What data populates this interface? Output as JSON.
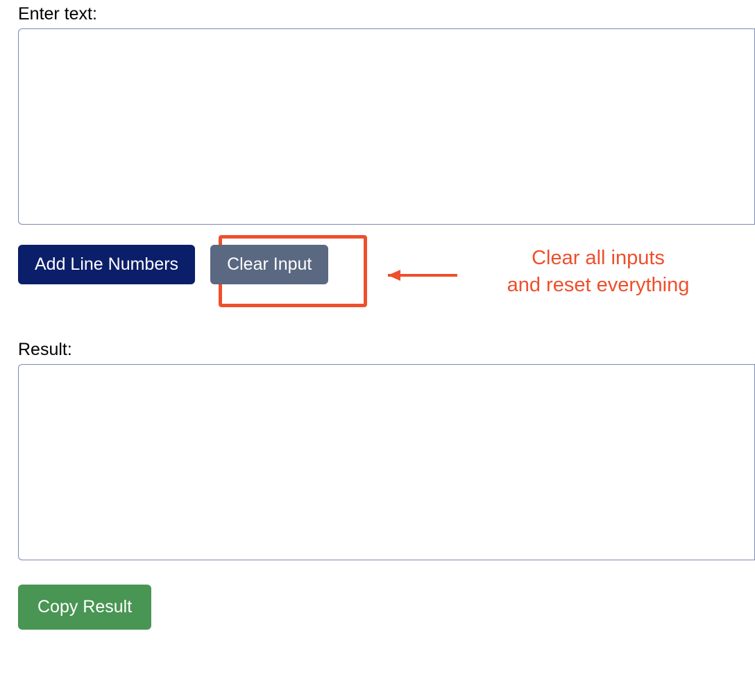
{
  "input": {
    "label": "Enter text:",
    "value": ""
  },
  "buttons": {
    "addLineNumbers": "Add Line Numbers",
    "clearInput": "Clear Input",
    "copyResult": "Copy Result"
  },
  "callout": {
    "line1": "Clear all inputs",
    "line2": "and reset everything"
  },
  "result": {
    "label": "Result:",
    "value": ""
  },
  "colors": {
    "primary": "#0b1e69",
    "secondary": "#5a6881",
    "success": "#499553",
    "highlight": "#ee4f2c",
    "border": "#7e87b5"
  }
}
